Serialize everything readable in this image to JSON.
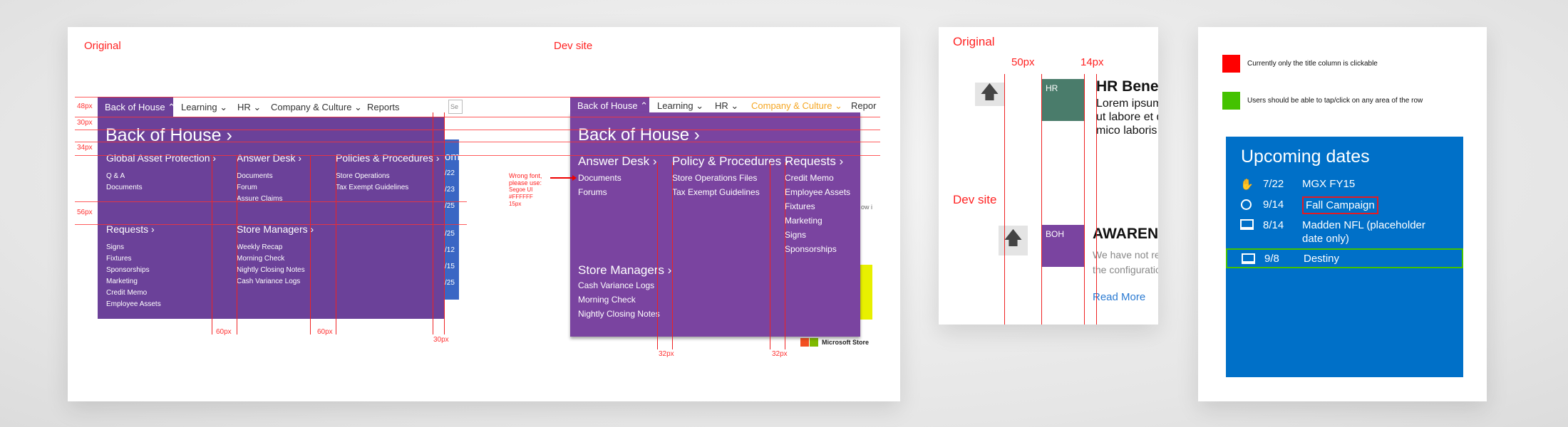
{
  "panel_main": {
    "original_label": "Original",
    "dev_label": "Dev site",
    "spacing_labels": {
      "h48": "48px",
      "h30": "30px",
      "h34": "34px",
      "h56": "56px",
      "v60a": "60px",
      "v60b": "60px",
      "v30": "30px",
      "v32a": "32px",
      "v32b": "32px"
    },
    "original": {
      "nav": [
        {
          "label": "Back of House ⌃",
          "active": true
        },
        {
          "label": "Learning ⌄"
        },
        {
          "label": "HR ⌄"
        },
        {
          "label": "Company & Culture ⌄"
        },
        {
          "label": "Reports"
        }
      ],
      "search_placeholder": "Se",
      "title": "Back of House ›",
      "sections": [
        {
          "heading": "Global Asset Protection ›",
          "links": [
            "Q & A",
            "Documents"
          ]
        },
        {
          "heading": "Answer Desk ›",
          "links": [
            "Documents",
            "Forum",
            "Assure Claims"
          ]
        },
        {
          "heading": "Policies & Procedures ›",
          "links": [
            "Store Operations",
            "Tax Exempt Guidelines"
          ]
        },
        {
          "heading": "Requests ›",
          "links": [
            "Signs",
            "Fixtures",
            "Sponsorships",
            "Marketing",
            "Credit Memo",
            "Employee Assets"
          ]
        },
        {
          "heading": "Store Managers ›",
          "links": [
            "Weekly Recap",
            "Morning Check",
            "Nightly Closing Notes",
            "Cash Variance Logs"
          ]
        }
      ],
      "behind_dates": [
        "/22",
        "/23",
        "/25",
        "/25",
        "/12",
        "/15",
        "/25"
      ],
      "behind_heading": "om"
    },
    "dev": {
      "nav": [
        {
          "label": "Back of House ⌃",
          "active": true
        },
        {
          "label": "Learning ⌄"
        },
        {
          "label": "HR ⌄"
        },
        {
          "label": "Company & Culture ⌄",
          "highlight": true
        },
        {
          "label": "Repor"
        }
      ],
      "title": "Back of House ›",
      "sections": [
        {
          "heading": "Answer Desk ›",
          "links": [
            "Documents",
            "Forums"
          ]
        },
        {
          "heading": "Policy & Procedures ›",
          "links": [
            "Store Operations Files",
            "Tax Exempt Guidelines"
          ]
        },
        {
          "heading": "Requests ›",
          "links": [
            "Credit Memo",
            "Employee Assets",
            "Fixtures",
            "Marketing",
            "Signs",
            "Sponsorships"
          ]
        },
        {
          "heading": "Store Managers ›",
          "links": [
            "Cash Variance Logs",
            "Morning Check",
            "Nightly Closing Notes"
          ]
        }
      ],
      "footer_brand": "Microsoft Store",
      "behind_text": "ow i"
    },
    "annotation": {
      "line1": "Wrong font,",
      "line2": "please use:",
      "line3": "Segoe UI",
      "line4": "#FFFFFF",
      "line5": "15px"
    }
  },
  "panel_tiles": {
    "original_label": "Original",
    "dev_label": "Dev site",
    "spacing_50": "50px",
    "spacing_14": "14px",
    "original": {
      "tag": "HR",
      "title": "HR Benefi",
      "lines": [
        "Lorem ipsum",
        "ut labore et d",
        "mico laboris"
      ]
    },
    "dev": {
      "tag": "BOH",
      "title": "AWARENE",
      "lines": [
        "We have not re",
        "the configuratio"
      ],
      "link": "Read More"
    }
  },
  "panel_dates": {
    "legend": [
      {
        "color": "#ff0000",
        "text": "Currently only the title column is clickable"
      },
      {
        "color": "#44c200",
        "text": "Users should be able to tap/click on any area of the row"
      }
    ],
    "title": "Upcoming dates",
    "rows": [
      {
        "icon": "gamepad-hand-icon",
        "date": "7/22",
        "title": "MGX FY15"
      },
      {
        "icon": "clock-icon",
        "date": "9/14",
        "title": "Fall Campaign"
      },
      {
        "icon": "laptop-icon",
        "date": "8/14",
        "title": "Madden NFL (placeholder",
        "title2": "date only)"
      },
      {
        "icon": "laptop-icon",
        "date": "9/8",
        "title": "Destiny"
      }
    ]
  },
  "colors": {
    "purple_original": "#6b4199",
    "purple_dev": "#7a44a0",
    "hr_green": "#4a7c6b",
    "blue": "#0070c8",
    "accent_orange": "#f5a623",
    "annotation_red": "#ff3333"
  }
}
